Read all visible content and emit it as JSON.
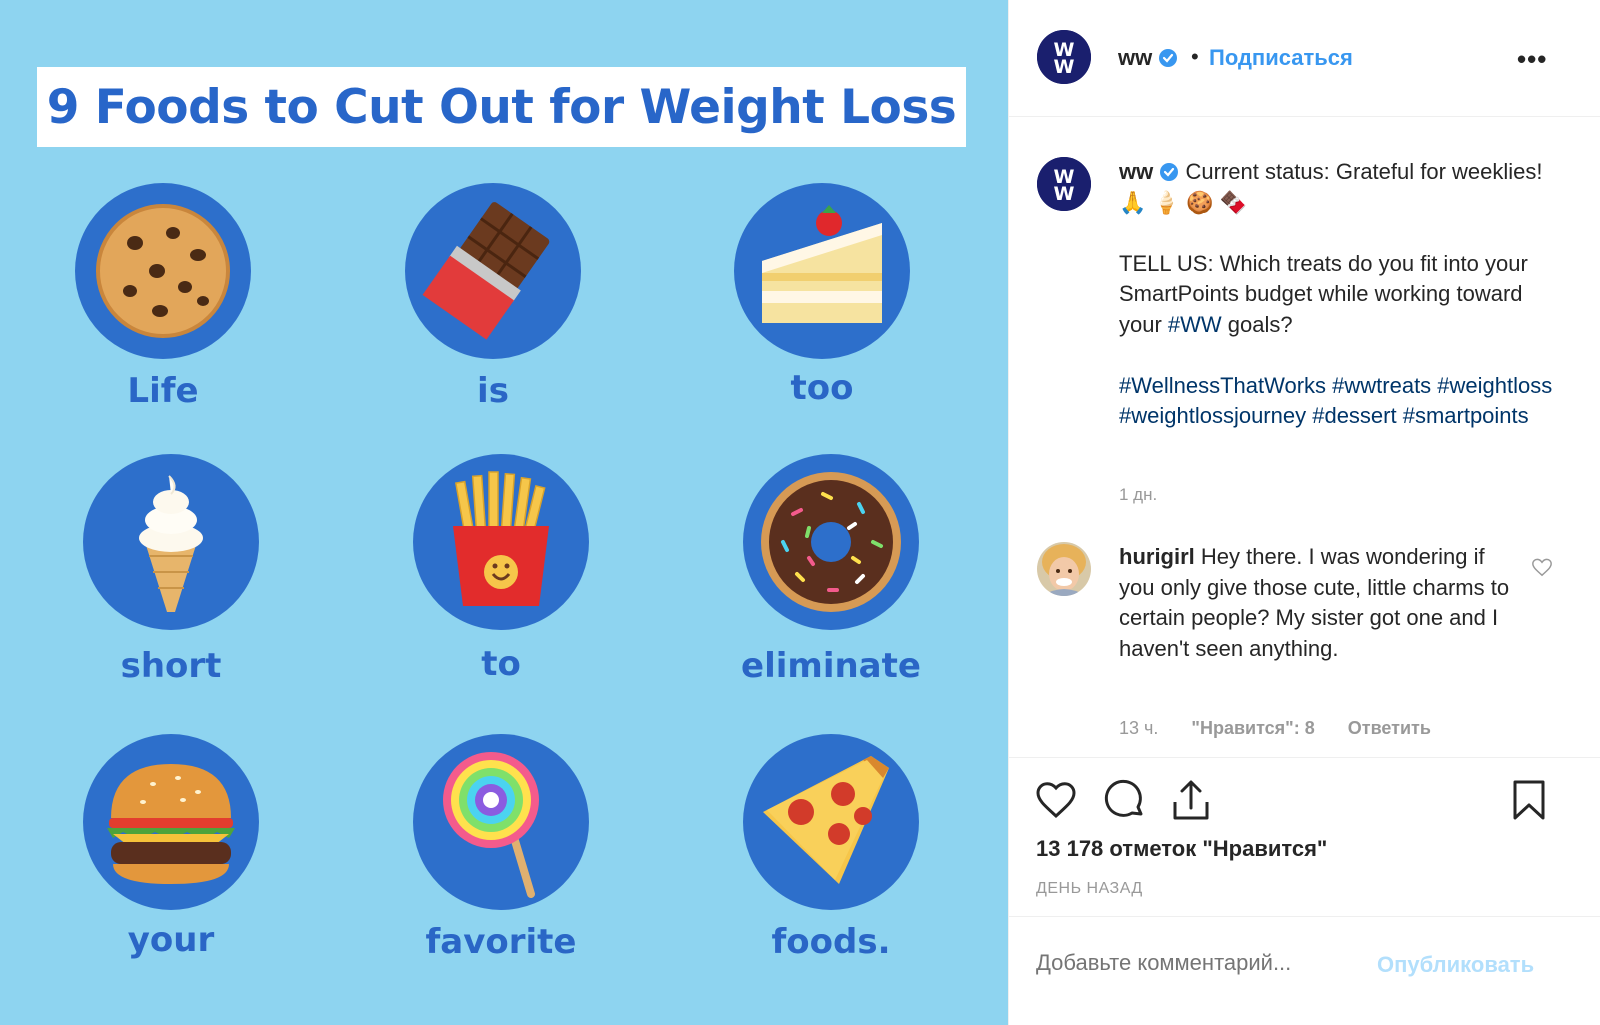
{
  "image": {
    "title": "9 Foods to Cut Out for Weight Loss",
    "words": [
      "Life",
      "is",
      "too",
      "short",
      "to",
      "eliminate",
      "your",
      "favorite",
      "foods."
    ],
    "foods": [
      "cookie-icon",
      "chocolate-bar-icon",
      "cake-icon",
      "soft-serve-icon",
      "fries-icon",
      "donut-icon",
      "burger-icon",
      "lollipop-icon",
      "pizza-icon"
    ],
    "colors": {
      "background": "#8ed4f0",
      "circle": "#2d6fcb",
      "text": "#2a66c6"
    }
  },
  "header": {
    "username": "ww",
    "dot": "•",
    "follow_label": "Подписаться",
    "more_label": "•••"
  },
  "caption": {
    "username": "ww",
    "line1": "Current status: Grateful for weeklies! 🙏 🍦 🍪 🍫",
    "question_part1": "TELL US: Which treats do you fit into your SmartPoints budget while working toward your ",
    "question_tag": "#WW",
    "question_part2": " goals?",
    "hashtags": "#WellnessThatWorks #wwtreats #weightloss #weightlossjourney #dessert #smartpoints",
    "time": "1 дн."
  },
  "comment": {
    "username": "hurigirl",
    "text": "Hey there. I was wondering if you only give those cute, little charms to certain people? My sister got one and I haven't seen anything.",
    "time": "13 ч.",
    "likes": "\"Нравится\": 8",
    "reply_label": "Ответить"
  },
  "actions": {
    "likes_count": "13 178 отметок \"Нравится\"",
    "date": "ДЕНЬ НАЗАД"
  },
  "add_comment": {
    "placeholder": "Добавьте комментарий...",
    "publish_label": "Опубликовать"
  },
  "colors": {
    "link": "#3897f0",
    "hashtag": "#003569",
    "muted": "#999999"
  }
}
